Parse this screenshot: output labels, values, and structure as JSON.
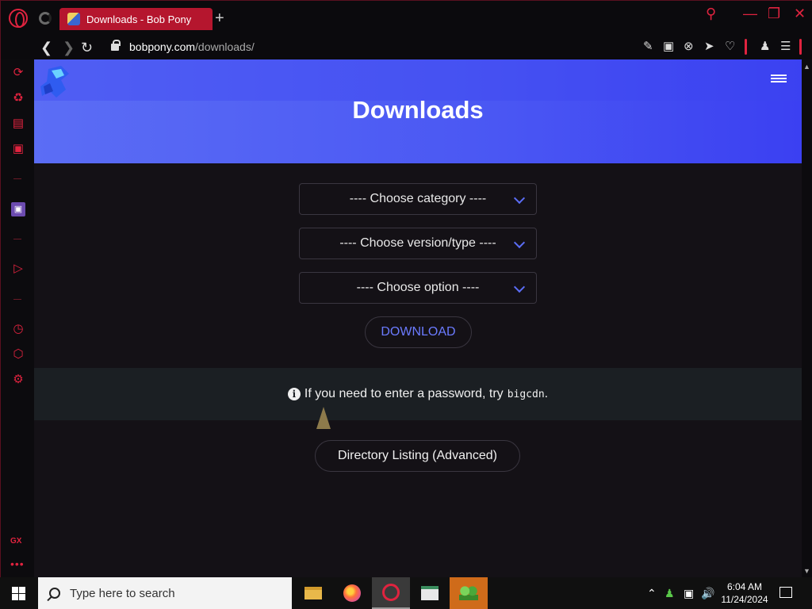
{
  "browser": {
    "tab_title": "Downloads - Bob Pony",
    "url_domain": "bobpony.com",
    "url_path": "/downloads/"
  },
  "page": {
    "title": "Downloads",
    "selects": [
      {
        "label": "---- Choose category ----"
      },
      {
        "label": "---- Choose version/type ----"
      },
      {
        "label": "---- Choose option ----"
      }
    ],
    "download_label": "DOWNLOAD",
    "notice_text": "If you need to enter a password, try",
    "notice_code": "bigcdn",
    "notice_end": ".",
    "directory_label": "Directory Listing (Advanced)"
  },
  "sidebar": {
    "gx_label": "GX",
    "more_label": "•••"
  },
  "taskbar": {
    "search_placeholder": "Type here to search",
    "time": "6:04 AM",
    "date": "11/24/2024"
  },
  "colors": {
    "accent_red": "#e0233f",
    "hero_blue": "#4a57f3",
    "link_blue": "#6b7bff"
  }
}
